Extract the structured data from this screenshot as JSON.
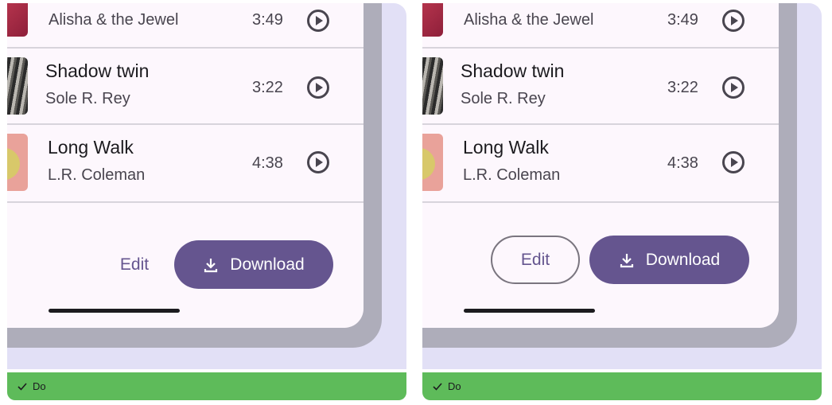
{
  "panels": [
    {
      "tracks": [
        {
          "title": "",
          "artist": "Alisha & the Jewel",
          "duration": "3:49"
        },
        {
          "title": "Shadow twin",
          "artist": "Sole R. Rey",
          "duration": "3:22"
        },
        {
          "title": "Long Walk",
          "artist": "L.R. Coleman",
          "duration": "4:38"
        }
      ],
      "edit_label": "Edit",
      "download_label": "Download",
      "verdict": "Do"
    },
    {
      "tracks": [
        {
          "title": "",
          "artist": "Alisha & the Jewel",
          "duration": "3:49"
        },
        {
          "title": "Shadow twin",
          "artist": "Sole R. Rey",
          "duration": "3:22"
        },
        {
          "title": "Long Walk",
          "artist": "L.R. Coleman",
          "duration": "4:38"
        }
      ],
      "edit_label": "Edit",
      "download_label": "Download",
      "verdict": "Do"
    }
  ],
  "colors": {
    "primary": "#65558f",
    "verdict_green": "#5ebb5a",
    "surface": "#fdf7fd",
    "backdrop": "#e2e0f6"
  }
}
